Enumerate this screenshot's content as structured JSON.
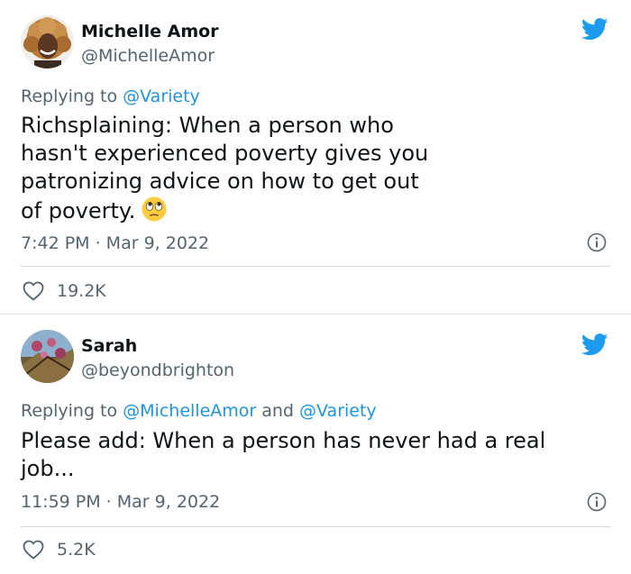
{
  "tweets": [
    {
      "name": "Michelle Amor",
      "handle": "@MichelleAmor",
      "reply_prefix": "Replying to ",
      "reply_mentions": "@Variety",
      "text": "Richsplaining: When a person who hasn't experienced poverty gives you patronizing advice on how to get out of poverty.",
      "emoji": "face-with-rolling-eyes",
      "time": "7:42 PM · Mar 9, 2022",
      "likes": "19.2K"
    },
    {
      "name": "Sarah",
      "handle": "@beyondbrighton",
      "reply_prefix": "Replying to ",
      "reply_mention_1": "@MichelleAmor",
      "reply_joiner": " and ",
      "reply_mention_2": "@Variety",
      "text": "Please add: When a person has never had a real job...",
      "time": "11:59 PM · Mar 9, 2022",
      "likes": "5.2K"
    }
  ],
  "colors": {
    "twitter_blue": "#1d9bf0",
    "mention": "#1b95e0",
    "secondary_text": "#536471",
    "primary_text": "#0f1419",
    "divider": "#cfd9de"
  },
  "icons": [
    "twitter-bird-icon",
    "info-icon",
    "heart-icon"
  ]
}
